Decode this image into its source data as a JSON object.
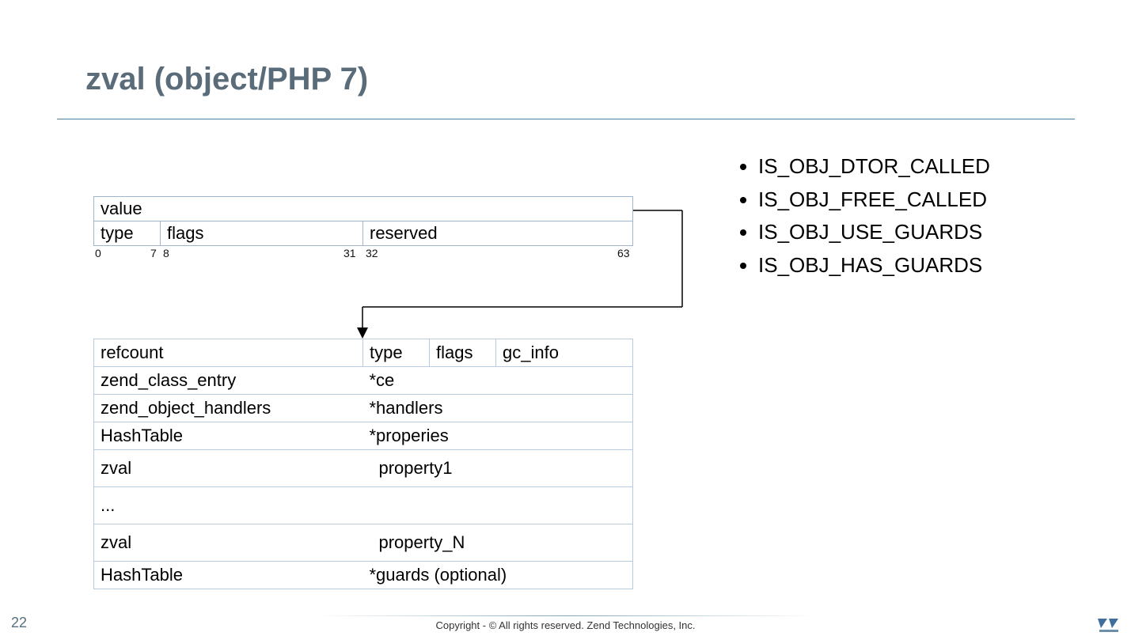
{
  "title": "zval (object/PHP 7)",
  "zval": {
    "row1": {
      "value": "value"
    },
    "row2": {
      "type": "type",
      "flags": "flags",
      "reserved": "reserved"
    },
    "bits": {
      "b0": "0",
      "b7": "7",
      "b8": "8",
      "b31": "31",
      "b32": "32",
      "b63": "63"
    }
  },
  "object": {
    "head": {
      "refcount": "refcount",
      "type": "type",
      "flags": "flags",
      "gc_info": "gc_info"
    },
    "rows": [
      {
        "left": "zend_class_entry",
        "right": "*ce"
      },
      {
        "left": "zend_object_handlers",
        "right": "*handlers"
      },
      {
        "left": "HashTable",
        "right": "*properies"
      },
      {
        "left": "zval",
        "right": "property1"
      },
      {
        "left": "...",
        "right": ""
      },
      {
        "left": "zval",
        "right": "property_N"
      },
      {
        "left": "HashTable",
        "right": "*guards (optional)"
      }
    ]
  },
  "flag_list": [
    "IS_OBJ_DTOR_CALLED",
    "IS_OBJ_FREE_CALLED",
    "IS_OBJ_USE_GUARDS",
    "IS_OBJ_HAS_GUARDS"
  ],
  "footer": {
    "page": "22",
    "copyright": "Copyright - © All rights reserved. Zend Technologies, Inc."
  },
  "colors": {
    "title": "#5a6c7a",
    "border": "#9fb6cc",
    "accent": "#4a7fa0"
  }
}
